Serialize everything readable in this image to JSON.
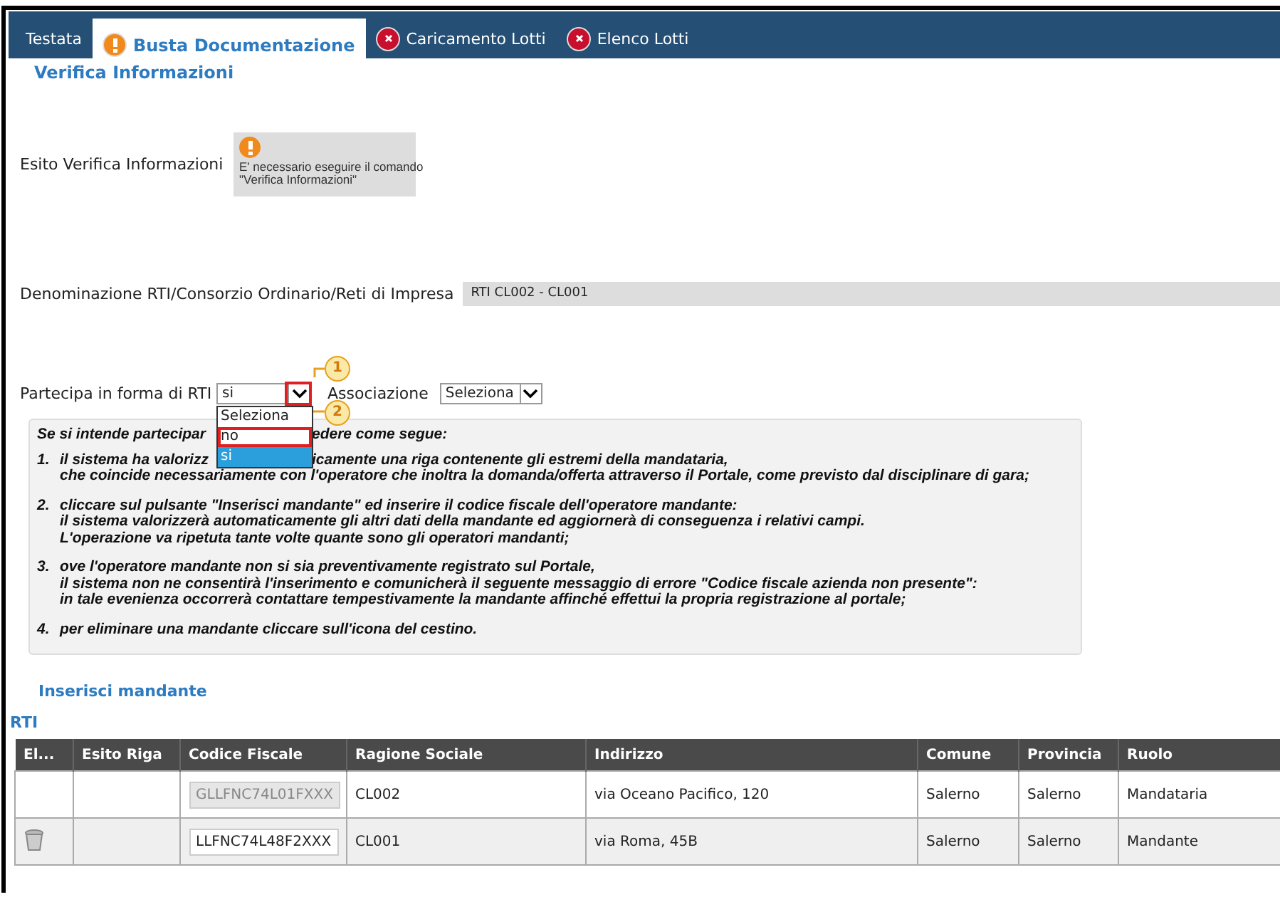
{
  "tabs": [
    {
      "label": "Testata",
      "kind": "plain",
      "selected": false
    },
    {
      "label": "Busta Documentazione",
      "kind": "warning",
      "selected": true
    },
    {
      "label": "Caricamento Lotti",
      "kind": "error",
      "selected": false
    },
    {
      "label": "Elenco Lotti",
      "kind": "error",
      "selected": false
    }
  ],
  "section_title": "Verifica Informazioni",
  "esito": {
    "label": "Esito Verifica Informazioni",
    "kind": "warning",
    "message": "E' necessario eseguire il comando\n\"Verifica Informazioni\""
  },
  "denominazione": {
    "label": "Denominazione RTI/Consorzio Ordinario/Reti di Impresa",
    "value": "RTI CL002 - CL001"
  },
  "partecipa": {
    "label": "Partecipa in forma di RTI",
    "value": "si",
    "open": true,
    "options": [
      {
        "label": "Seleziona",
        "selected": false,
        "highlighted": false
      },
      {
        "label": "no",
        "selected": false,
        "highlighted": true
      },
      {
        "label": "si",
        "selected": true,
        "highlighted": false
      }
    ]
  },
  "associazione": {
    "label": "Associazione",
    "value": "Seleziona"
  },
  "callouts": [
    {
      "number": "1"
    },
    {
      "number": "2"
    }
  ],
  "instructions": {
    "intro": [
      "Se si intende partecipar",
      "edere come segue:"
    ],
    "items": [
      {
        "number": "1.",
        "lines": [
          [
            "il sistema ha valorizz",
            "icamente una riga contenente gli estremi della mandataria,"
          ],
          [
            "che coincide necessariamente con l'operatore che inoltra la domanda/offerta attraverso il Portale, come previsto dal disciplinare di gara;"
          ]
        ]
      },
      {
        "number": "2.",
        "lines": [
          [
            "cliccare sul pulsante \"Inserisci mandante\" ed inserire il codice fiscale dell'operatore mandante:"
          ],
          [
            "il sistema valorizzerà automaticamente gli altri dati della mandante ed aggiornerà di conseguenza i relativi campi."
          ],
          [
            "L'operazione va ripetuta tante volte quante sono gli operatori mandanti;"
          ]
        ]
      },
      {
        "number": "3.",
        "lines": [
          [
            "ove l'operatore mandante non si sia preventivamente registrato sul Portale,"
          ],
          [
            "il sistema non ne consentirà l'inserimento e comunicherà il seguente messaggio di errore \"Codice fiscale azienda non presente\":"
          ],
          [
            "in tale evenienza occorrerà contattare tempestivamente la mandante affinché effettui la propria registrazione al portale;"
          ]
        ]
      },
      {
        "number": "4.",
        "lines": [
          [
            "per eliminare una mandante cliccare sull'icona del cestino."
          ]
        ]
      }
    ]
  },
  "insert_link": "Inserisci mandante",
  "table": {
    "title": "RTI",
    "columns": [
      "El...",
      "Esito Riga",
      "Codice Fiscale",
      "Ragione Sociale",
      "Indirizzo",
      "Comune",
      "Provincia",
      "Ruolo"
    ],
    "rows": [
      {
        "deletable": false,
        "codice_fiscale": "GLLFNC74L01FXXX",
        "codice_disabled": true,
        "ragione_sociale": "CL002",
        "indirizzo": "via Oceano Pacifico, 120",
        "comune": "Salerno",
        "provincia": "Salerno",
        "ruolo": "Mandataria"
      },
      {
        "deletable": true,
        "codice_fiscale": "LLFNC74L48F2XXX",
        "codice_disabled": false,
        "ragione_sociale": "CL001",
        "indirizzo": "via Roma, 45B",
        "comune": "Salerno",
        "provincia": "Salerno",
        "ruolo": "Mandante"
      }
    ]
  }
}
